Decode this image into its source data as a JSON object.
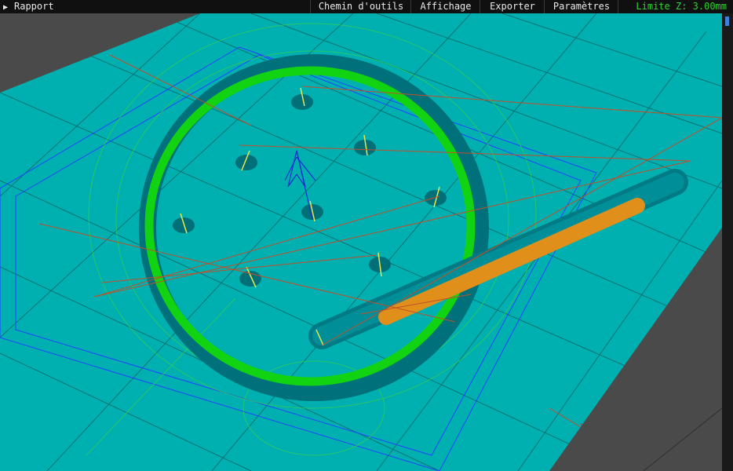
{
  "menubar": {
    "report_label": "Rapport",
    "items": [
      {
        "label": "Chemin d'outils"
      },
      {
        "label": "Affichage"
      },
      {
        "label": "Exporter"
      },
      {
        "label": "Paramètres"
      }
    ],
    "z_limit": "Limite Z: 3.00mm"
  },
  "icons": {
    "report_toggle": "triangle-right-icon"
  },
  "colors": {
    "stock_surface": "#00b0b0",
    "stock_shadow": "#007f86",
    "ring_toolpath": "#11d311",
    "slot_toolpath": "#e08f1a",
    "background": "#4a4a4a",
    "z_limit_text": "#2fd02f",
    "scroll_thumb": "#3f7fd9"
  }
}
